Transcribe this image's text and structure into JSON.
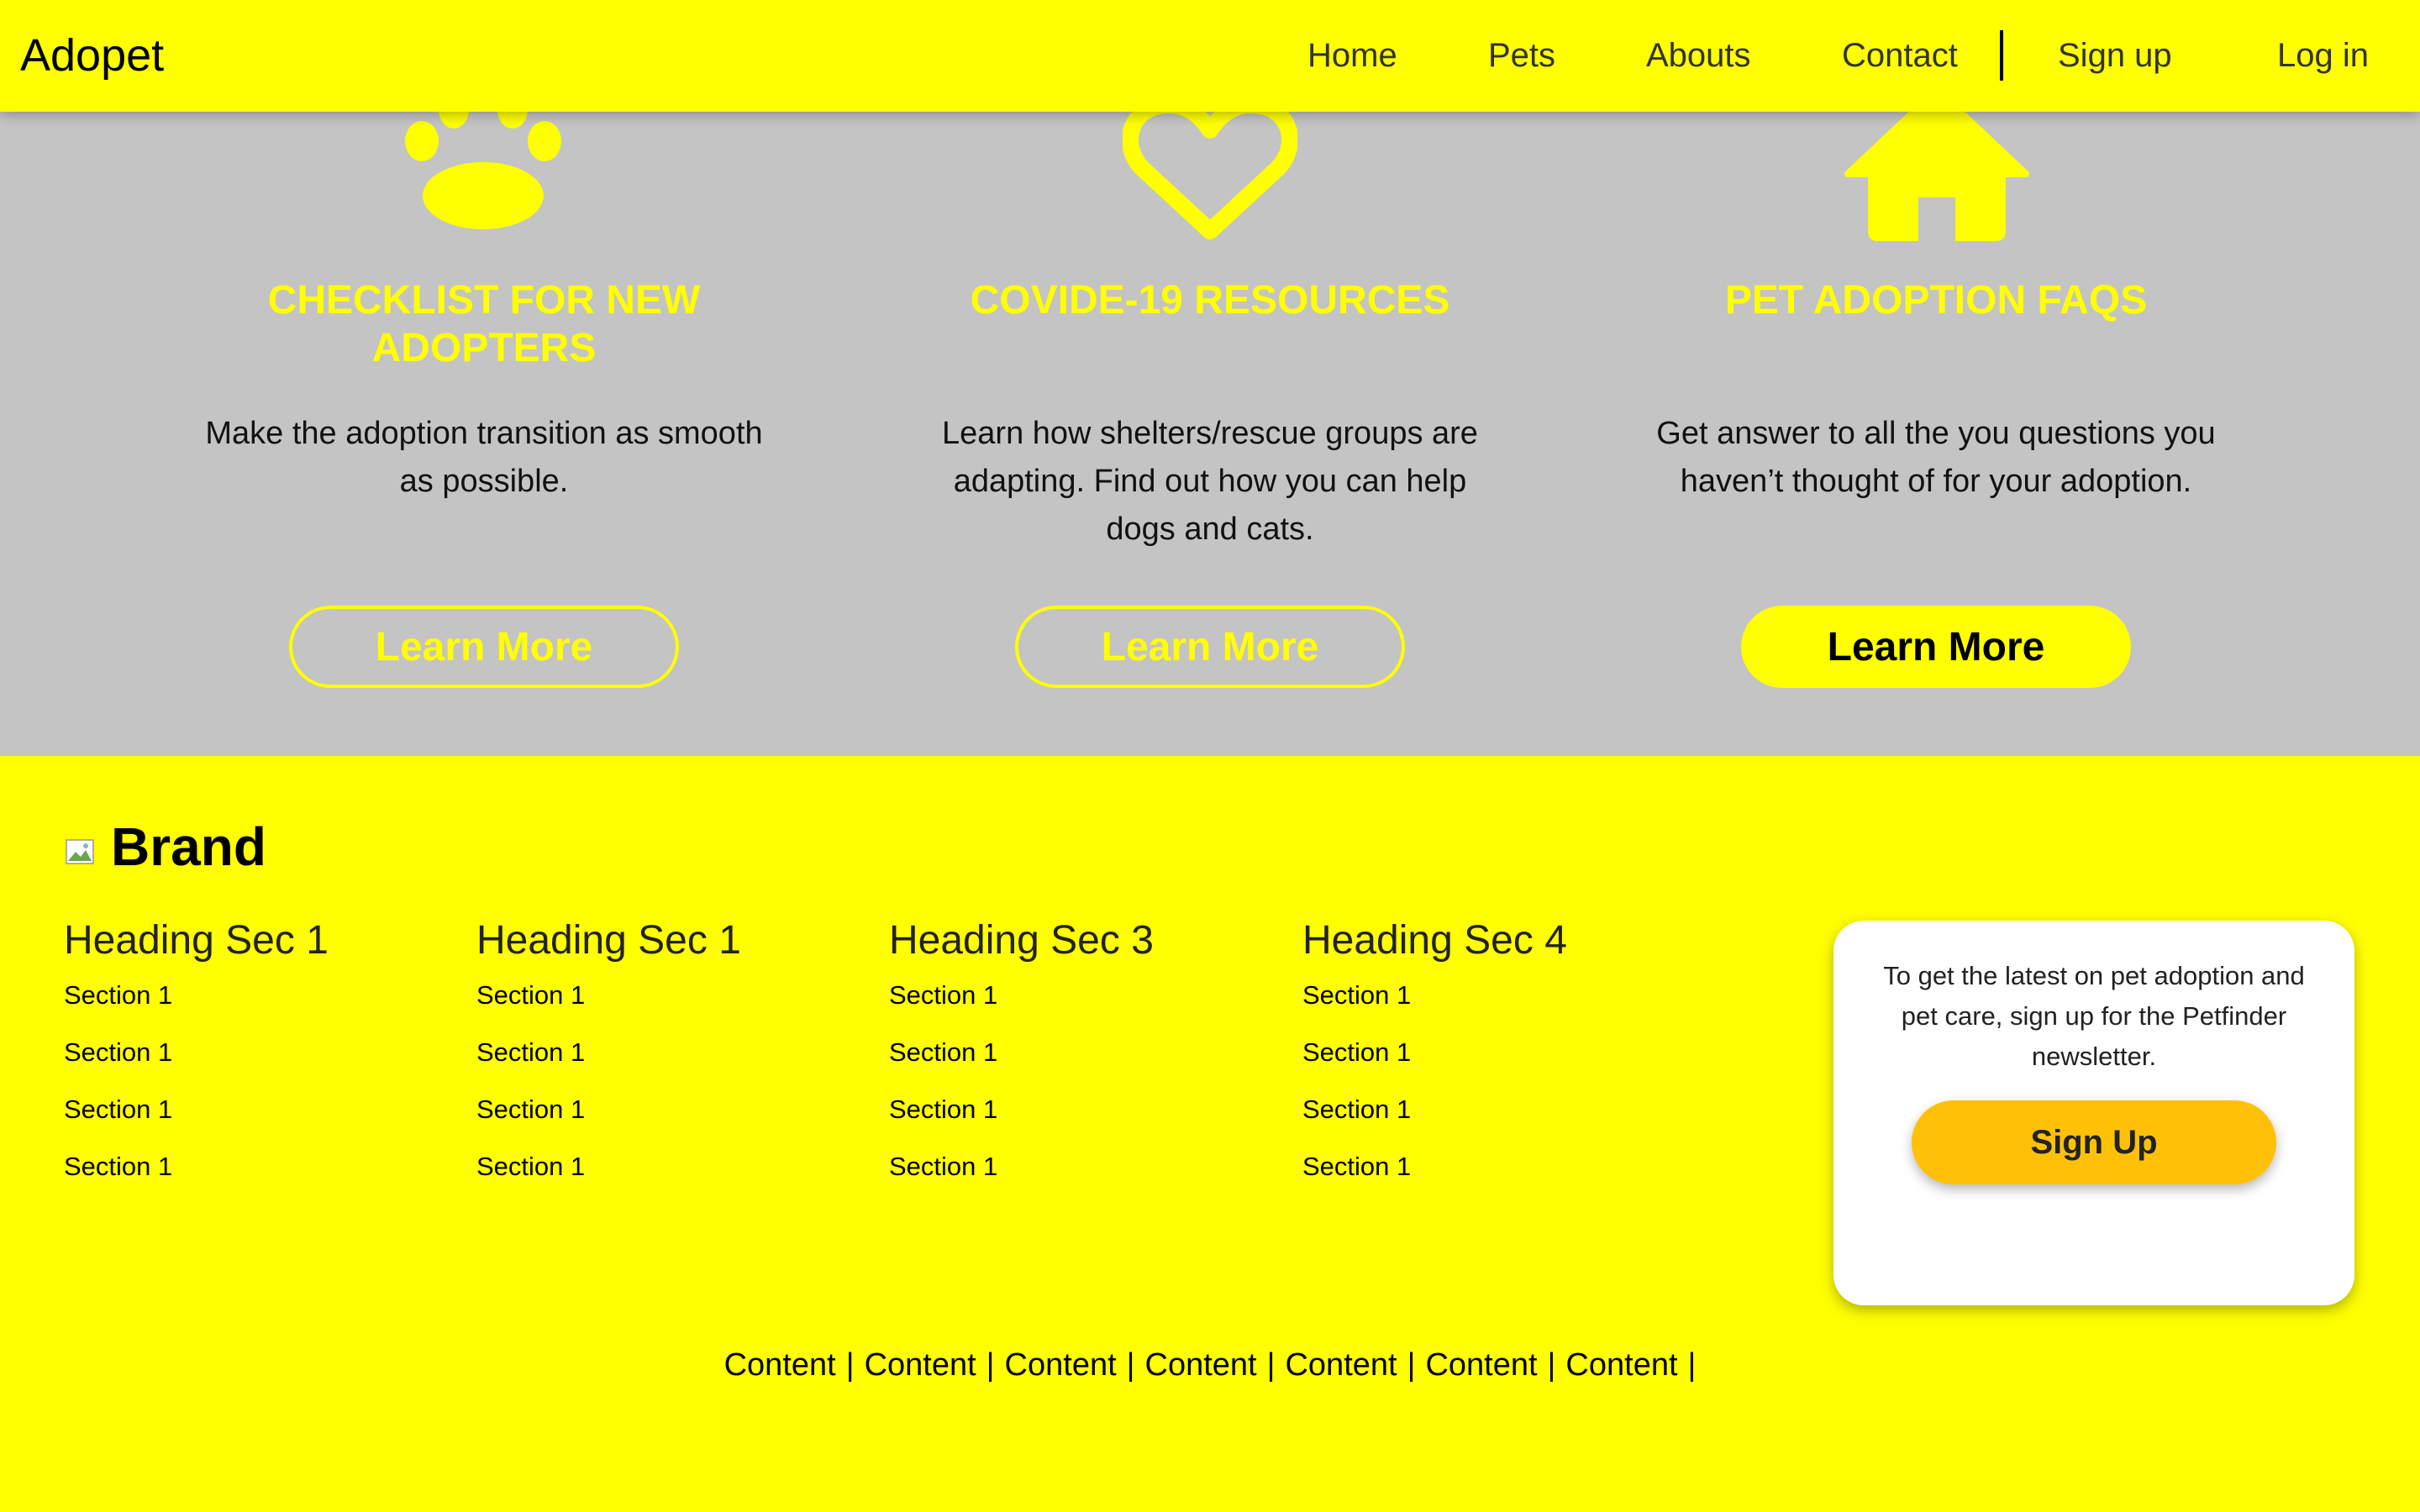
{
  "colors": {
    "accent": "#ffff00",
    "band": "#c4c4c4",
    "signup": "#ffc107"
  },
  "navbar": {
    "brand": "Adopet",
    "links": [
      "Home",
      "Pets",
      "Abouts",
      "Contact"
    ],
    "signup": "Sign up",
    "login": "Log in"
  },
  "features": [
    {
      "icon": "paw-icon",
      "title": "CHECKLIST FOR NEW ADOPTERS",
      "description": "Make the adoption transition as smooth as possible.",
      "button": "Learn More"
    },
    {
      "icon": "heart-icon",
      "title": "COVIDE-19 RESOURCES",
      "description": "Learn how shelters/rescue groups are adapting. Find out how you can help dogs and cats.",
      "button": "Learn More"
    },
    {
      "icon": "house-icon",
      "title": "PET ADOPTION FAQS",
      "description": "Get answer to all the you questions you haven’t thought of for your adoption.",
      "button": "Learn More"
    }
  ],
  "footer": {
    "brand": "Brand",
    "columns": [
      {
        "heading": "Heading Sec 1",
        "links": [
          "Section 1",
          "Section 1",
          "Section 1",
          "Section 1"
        ]
      },
      {
        "heading": "Heading Sec 1",
        "links": [
          "Section 1",
          "Section 1",
          "Section 1",
          "Section 1"
        ]
      },
      {
        "heading": "Heading Sec 3",
        "links": [
          "Section 1",
          "Section 1",
          "Section 1",
          "Section 1"
        ]
      },
      {
        "heading": "Heading Sec 4",
        "links": [
          "Section 1",
          "Section 1",
          "Section 1",
          "Section 1"
        ]
      }
    ],
    "newsletter": {
      "text": "To get the latest on pet adoption and pet care, sign up for the Petfinder newsletter.",
      "button": "Sign Up"
    },
    "bottom_links": [
      "Content",
      "Content",
      "Content",
      "Content",
      "Content",
      "Content",
      "Content"
    ],
    "separator": "|"
  }
}
